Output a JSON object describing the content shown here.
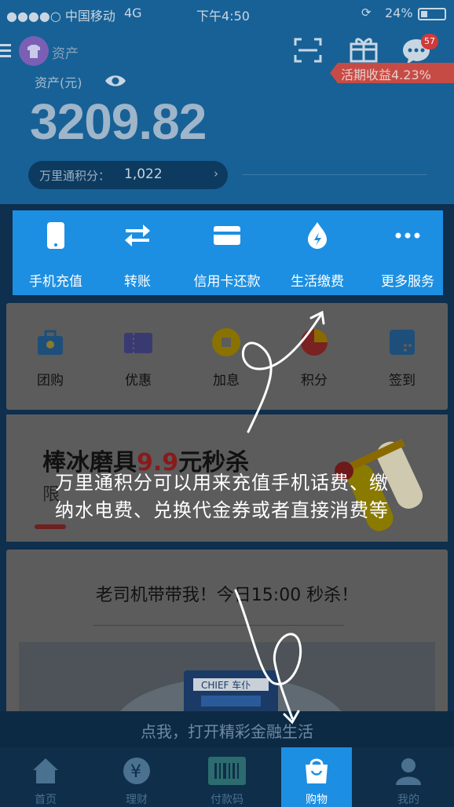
{
  "status_bar": {
    "carrier": "●●●●○ 中国移动",
    "network": "4G",
    "time": "下午4:50",
    "battery": "24%"
  },
  "header": {
    "account_label": "资产",
    "balance_label": "资产(元)",
    "balance": "3209.82",
    "points_label": "万里通积分：",
    "points_value": "1,022",
    "interest_badge": "活期收益4.23%",
    "message_count": "57"
  },
  "services": [
    {
      "label": "手机充值",
      "icon": "phone-icon"
    },
    {
      "label": "转账",
      "icon": "transfer-icon"
    },
    {
      "label": "信用卡还款",
      "icon": "credit-card-icon"
    },
    {
      "label": "生活缴费",
      "icon": "utility-icon"
    },
    {
      "label": "更多服务",
      "icon": "more-icon"
    }
  ],
  "quick_links": [
    {
      "label": "团购",
      "icon": "group-buy-icon"
    },
    {
      "label": "优惠",
      "icon": "coupon-icon"
    },
    {
      "label": "加息",
      "icon": "coin-icon"
    },
    {
      "label": "积分",
      "icon": "points-icon"
    },
    {
      "label": "签到",
      "icon": "checkin-icon"
    }
  ],
  "promo": {
    "title_prefix": "棒冰磨具",
    "price": "9.9",
    "title_suffix": "元秒杀",
    "sub": "限"
  },
  "flash": {
    "title": "老司机带带我！今日15:00 秒杀！"
  },
  "tooltip": {
    "text": "万里通积分可以用来充值手机话费、缴纳水电费、兑换代金券或者直接消费等"
  },
  "cta": {
    "text": "点我，打开精彩金融生活"
  },
  "tabbar": [
    {
      "label": "首页",
      "icon": "home-icon"
    },
    {
      "label": "理财",
      "icon": "yuan-icon"
    },
    {
      "label": "付款码",
      "icon": "barcode-icon"
    },
    {
      "label": "购物",
      "icon": "shopping-bag-icon"
    },
    {
      "label": "我的",
      "icon": "person-icon"
    }
  ],
  "colors": {
    "service_blue": "#1c8fe2",
    "price_yellow": "#f2c400",
    "badge_red": "#d13a3a",
    "dim_overlay": "#0d2a44"
  }
}
